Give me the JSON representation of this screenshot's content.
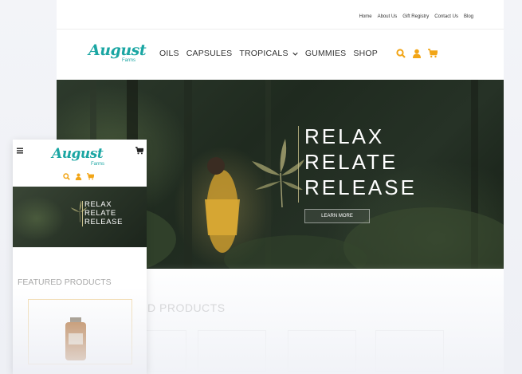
{
  "utility_nav": [
    "Home",
    "About Us",
    "Gift Registry",
    "Contact Us",
    "Blog"
  ],
  "logo": {
    "word": "August",
    "sub": "Farms"
  },
  "main_nav": [
    "OILS",
    "CAPSULES",
    "TROPICALS",
    "GUMMIES",
    "SHOP"
  ],
  "hero": {
    "lines": [
      "RELAX",
      "RELATE",
      "RELEASE"
    ],
    "button": "LEARN MORE"
  },
  "featured": {
    "desktop_partial": "D PRODUCTS",
    "mobile": "FEATURED PRODUCTS"
  },
  "colors": {
    "brand": "#1aa6a3",
    "icon_orange": "#f2a516"
  },
  "icons": [
    "search-icon",
    "user-icon",
    "cart-icon",
    "menu-icon",
    "chevron-down-icon",
    "leaf-icon"
  ]
}
